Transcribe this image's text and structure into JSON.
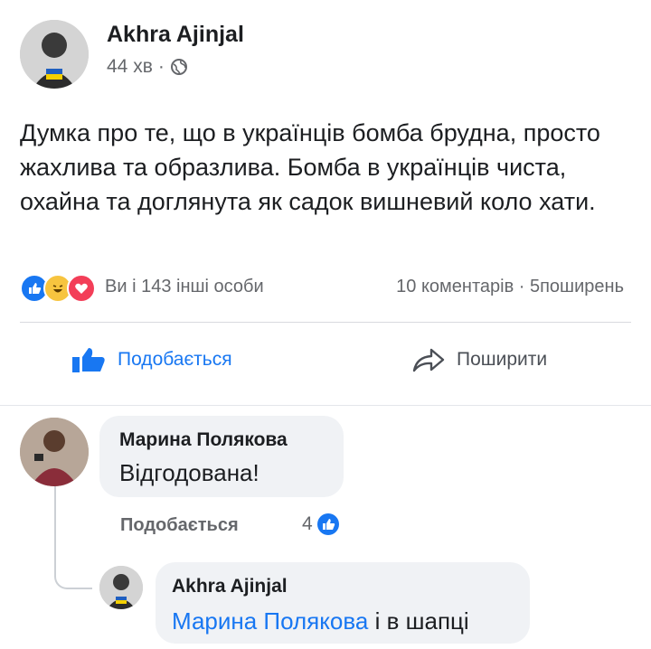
{
  "post": {
    "author": "Akhra Ajinjal",
    "time": "44 хв",
    "separator": "·",
    "privacy_icon": "globe-icon",
    "text": "Думка про те, що в українців бомба брудна, просто жахлива та образлива. Бомба  в українців чиста, охайна та доглянута як садок вишневий коло хати."
  },
  "reactions": {
    "icons": [
      "like-reaction-icon",
      "haha-reaction-icon",
      "love-reaction-icon"
    ],
    "summary": "Ви і 143 інші особи",
    "comments_shares": "10 коментарів · 5поширень"
  },
  "actions": {
    "like_label": "Подобається",
    "share_label": "Поширити"
  },
  "comments": [
    {
      "author": "Марина Полякова",
      "text": "Відгодована!",
      "like_label": "Подобається",
      "like_count": "4"
    }
  ],
  "reply": {
    "author": "Akhra Ajinjal",
    "mention": "Марина Полякова",
    "text": " і в шапці"
  },
  "colors": {
    "accent": "#1877f2",
    "bubble": "#f0f2f5",
    "secondary_text": "#65676b"
  }
}
